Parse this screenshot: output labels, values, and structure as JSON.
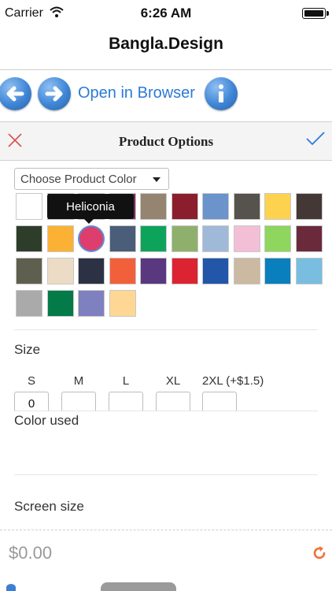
{
  "status_bar": {
    "carrier": "Carrier",
    "time": "6:26 AM"
  },
  "nav": {
    "title": "Bangla.Design"
  },
  "toolbar": {
    "back_icon": "arrow-left-icon",
    "forward_icon": "arrow-right-icon",
    "open_in_browser": "Open in Browser",
    "info_icon": "info-icon"
  },
  "options": {
    "title": "Product Options",
    "close_icon": "close-icon",
    "confirm_icon": "check-icon"
  },
  "color_picker": {
    "dropdown_label": "Choose Product Color",
    "tooltip": "Heliconia",
    "swatches": [
      "#ffffff",
      "#1a1a1a",
      "#2b2b2b",
      "#7a2f5a",
      "#958570",
      "#8b1e2d",
      "#6b93cc",
      "#56524d",
      "#fdd24e",
      "#433836",
      "#2e3d2a",
      "#fbb133",
      "#dd3e6d",
      "#4a5d79",
      "#0ea35a",
      "#8eb06c",
      "#9fb9d9",
      "#f2bfd6",
      "#8ed65d",
      "#6b2a3c",
      "#5f5f4f",
      "#ecdcc5",
      "#2c3244",
      "#f2603b",
      "#5a3880",
      "#dc2332",
      "#2156a8",
      "#cbb9a1",
      "#0a7fbd",
      "#79bde1",
      "#aaaaaa",
      "#047a48",
      "#7f80c0",
      "#fed795"
    ],
    "selected_index": 12
  },
  "size": {
    "label": "Size",
    "options": [
      {
        "label": "S",
        "value": "0"
      },
      {
        "label": "M",
        "value": ""
      },
      {
        "label": "L",
        "value": ""
      },
      {
        "label": "XL",
        "value": ""
      },
      {
        "label": "2XL (+$1.5)",
        "value": ""
      }
    ]
  },
  "color_used": {
    "label": "Color used"
  },
  "screen_size": {
    "label": "Screen size"
  },
  "footer": {
    "price": "$0.00",
    "refresh_icon": "refresh-icon"
  },
  "colors": {
    "accent": "#2b7bd6",
    "close": "#d9534f",
    "refresh": "#f0703a"
  }
}
